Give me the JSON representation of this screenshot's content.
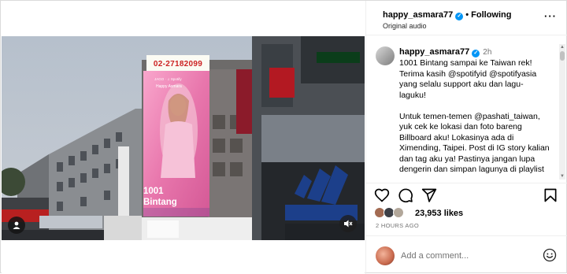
{
  "post": {
    "username": "happy_asmara77",
    "following_label": "Following",
    "audio_label": "Original audio",
    "comment_time": "2h",
    "caption": "1001 Bintang sampai ke Taiwan rek!\nTerima kasih @spotifyid @spotifyasia\nyang selalu support aku dan lagu-\nlaguku!\n\nUntuk temen-temen @pashati_taiwan,\nyuk cek ke lokasi dan foto bareng\nBillboard aku! Lokasinya ada di\nXimending, Taipei. Post di IG story kalian\ndan tag aku ya! Pastinya jangan lupa\ndengerin dan simpan lagunya di playlist",
    "likes_count": "23,953 likes",
    "time_ago": "2 HOURS AGO"
  },
  "billboard": {
    "phone": "02-27182099",
    "brand": "JAGO · ♫ Spotify",
    "artist": "Happy Asmara",
    "song_title": "1001\nBintang"
  },
  "comment_box": {
    "placeholder": "Add a comment..."
  },
  "icons": {
    "header_more": "more-options-icon",
    "verified": "verified-badge-icon",
    "like": "heart-icon",
    "comment": "comment-icon",
    "share": "share-icon",
    "save": "bookmark-icon",
    "emoji": "emoji-icon",
    "sound": "sound-muted-icon",
    "tags": "user-tag-icon"
  },
  "colors": {
    "verified_blue": "#0095f6",
    "billboard_pink": "#f07ab0",
    "phone_red": "#cc2222"
  }
}
